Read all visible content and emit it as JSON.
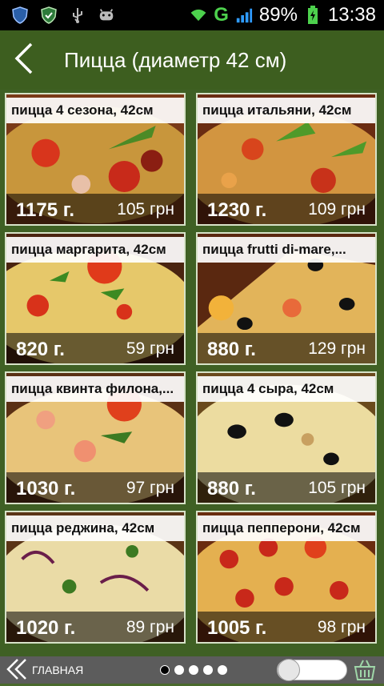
{
  "status_bar": {
    "network": "G",
    "battery": "89%",
    "time": "13:38",
    "icons": [
      "shield-icon",
      "shield-check-icon",
      "usb-icon",
      "android-icon",
      "wifi-icon",
      "signal-icon",
      "battery-icon"
    ]
  },
  "header": {
    "title": "Пицца (диаметр 42 см)",
    "back_icon": "chevron-left-icon"
  },
  "products": [
    {
      "name": "пицца 4 сезона, 42см",
      "weight": "1175 г.",
      "price": "105 грн"
    },
    {
      "name": "пицца итальяни, 42см",
      "weight": "1230 г.",
      "price": "109 грн"
    },
    {
      "name": "пицца маргарита, 42см",
      "weight": "820 г.",
      "price": "59 грн"
    },
    {
      "name": "пицца frutti di-mare,...",
      "weight": "880 г.",
      "price": "129 грн"
    },
    {
      "name": "пицца квинта филона,...",
      "weight": "1030 г.",
      "price": "97 грн"
    },
    {
      "name": "пицца 4 сыра, 42см",
      "weight": "880 г.",
      "price": "105 грн"
    },
    {
      "name": "пицца реджина, 42см",
      "weight": "1020 г.",
      "price": "89 грн"
    },
    {
      "name": "пицца пепперони, 42см",
      "weight": "1005 г.",
      "price": "98 грн"
    }
  ],
  "bottom_bar": {
    "home_label": "ГЛАВНАЯ",
    "page_count": 5,
    "active_page": 1,
    "toggle_on": false,
    "cart_icon": "basket-icon"
  },
  "colors": {
    "header_bg": "#3d5e1f",
    "grid_bg": "#3f6024",
    "card_border": "#d7e2c8",
    "bottom_bar_bg": "#5c5c5c"
  }
}
